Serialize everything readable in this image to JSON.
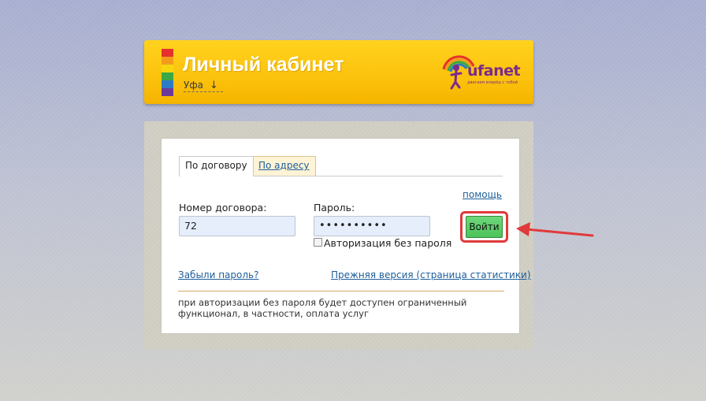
{
  "header": {
    "title": "Личный кабинет",
    "city": "Уфа",
    "city_arrow": "↓",
    "logo_text": "ufanet",
    "logo_tagline": "двигаем вперёд с тобой"
  },
  "colors": {
    "header_bg": "#fcc20c",
    "stripes": [
      "#e5312d",
      "#f39c1b",
      "#f6d60f",
      "#3aa844",
      "#2d7bc4",
      "#6b3a98"
    ],
    "accent_link": "#1d5e9b",
    "login_button": "#4dc35a",
    "annotation_red": "#e03a3a"
  },
  "tabs": [
    {
      "label": "По договору",
      "active": true
    },
    {
      "label": "По адресу",
      "active": false
    }
  ],
  "form": {
    "help_link": "помощь",
    "contract_label": "Номер договора:",
    "contract_value": "72",
    "password_label": "Пароль:",
    "password_value": "••••••••••",
    "checkbox_label": "Авторизация без пароля",
    "login_button": "Войти",
    "forgot_link": "Забыли пароль?",
    "old_version_link": "Прежняя версия (страница статистики)",
    "note": "при авторизации без пароля будет доступен ограниченный функционал, в частности, оплата услуг"
  }
}
